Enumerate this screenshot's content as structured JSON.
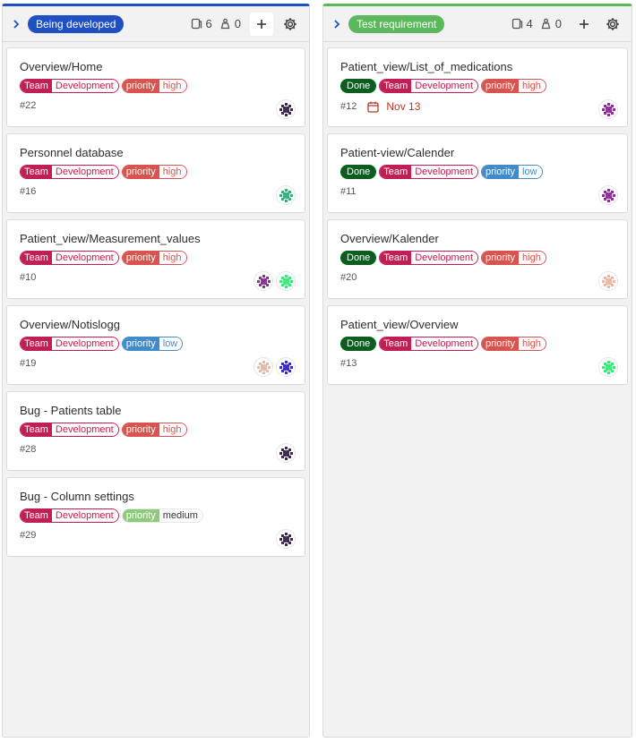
{
  "columns": [
    {
      "title": "Being developed",
      "title_color": "#1f4fc2",
      "issues_count": "6",
      "weight_count": "0",
      "cards": [
        {
          "title": "Overview/Home",
          "number": "#22",
          "labels": [
            {
              "kind": "scoped",
              "key": "Team",
              "value": "Development"
            },
            {
              "kind": "scoped",
              "key": "priority",
              "value": "high"
            }
          ],
          "avatars": [
            "dark"
          ]
        },
        {
          "title": "Personnel database",
          "number": "#16",
          "labels": [
            {
              "kind": "scoped",
              "key": "Team",
              "value": "Development"
            },
            {
              "kind": "scoped",
              "key": "priority",
              "value": "high"
            }
          ],
          "avatars": [
            "teal"
          ]
        },
        {
          "title": "Patient_view/Measurement_values",
          "number": "#10",
          "labels": [
            {
              "kind": "scoped",
              "key": "Team",
              "value": "Development"
            },
            {
              "kind": "scoped",
              "key": "priority",
              "value": "high"
            }
          ],
          "avatars": [
            "purple",
            "green"
          ]
        },
        {
          "title": "Overview/Notislogg",
          "number": "#19",
          "labels": [
            {
              "kind": "scoped",
              "key": "Team",
              "value": "Development"
            },
            {
              "kind": "scoped",
              "key": "priority",
              "value": "low"
            }
          ],
          "avatars": [
            "peach",
            "blue"
          ]
        },
        {
          "title": "Bug - Patients table",
          "number": "#28",
          "labels": [
            {
              "kind": "scoped",
              "key": "Team",
              "value": "Development"
            },
            {
              "kind": "scoped",
              "key": "priority",
              "value": "high"
            }
          ],
          "avatars": [
            "dark"
          ]
        },
        {
          "title": "Bug - Column settings",
          "number": "#29",
          "labels": [
            {
              "kind": "scoped",
              "key": "Team",
              "value": "Development"
            },
            {
              "kind": "scoped",
              "key": "priority",
              "value": "medium"
            }
          ],
          "avatars": [
            "dark"
          ]
        }
      ]
    },
    {
      "title": "Test requirement",
      "title_color": "#5cb85c",
      "issues_count": "4",
      "weight_count": "0",
      "cards": [
        {
          "title": "Patient_view/List_of_medications",
          "number": "#12",
          "due": "Nov 13",
          "labels": [
            {
              "kind": "simple",
              "value": "Done"
            },
            {
              "kind": "scoped",
              "key": "Team",
              "value": "Development"
            },
            {
              "kind": "scoped",
              "key": "priority",
              "value": "high"
            }
          ],
          "avatars": [
            "purple"
          ]
        },
        {
          "title": "Patient-view/Calender",
          "number": "#11",
          "labels": [
            {
              "kind": "simple",
              "value": "Done"
            },
            {
              "kind": "scoped",
              "key": "Team",
              "value": "Development"
            },
            {
              "kind": "scoped",
              "key": "priority",
              "value": "low"
            }
          ],
          "avatars": [
            "purple"
          ]
        },
        {
          "title": "Overview/Kalender",
          "number": "#20",
          "labels": [
            {
              "kind": "simple",
              "value": "Done"
            },
            {
              "kind": "scoped",
              "key": "Team",
              "value": "Development"
            },
            {
              "kind": "scoped",
              "key": "priority",
              "value": "high"
            }
          ],
          "avatars": [
            "peach"
          ]
        },
        {
          "title": "Patient_view/Overview",
          "number": "#13",
          "labels": [
            {
              "kind": "simple",
              "value": "Done"
            },
            {
              "kind": "scoped",
              "key": "Team",
              "value": "Development"
            },
            {
              "kind": "scoped",
              "key": "priority",
              "value": "high"
            }
          ],
          "avatars": [
            "green"
          ]
        }
      ]
    }
  ],
  "colors": {
    "team": "#c21e56",
    "priority_high": "#d9534f",
    "priority_low": "#428bca",
    "priority_medium": "#8fc97a",
    "done": "#0b5e1e",
    "due": "#c0341d"
  },
  "avatar_palette": {
    "dark": "#3c2a4a",
    "teal": "#3cae7a",
    "purple": "#8e2f9a",
    "green": "#3ee77a",
    "peach": "#e9b8a6",
    "blue": "#3a2bc4"
  },
  "icons": {
    "collapse": "chevron-right-icon",
    "issues": "issues-icon",
    "weight": "weight-icon",
    "add": "plus-icon",
    "settings": "gear-icon",
    "due": "calendar-icon"
  }
}
